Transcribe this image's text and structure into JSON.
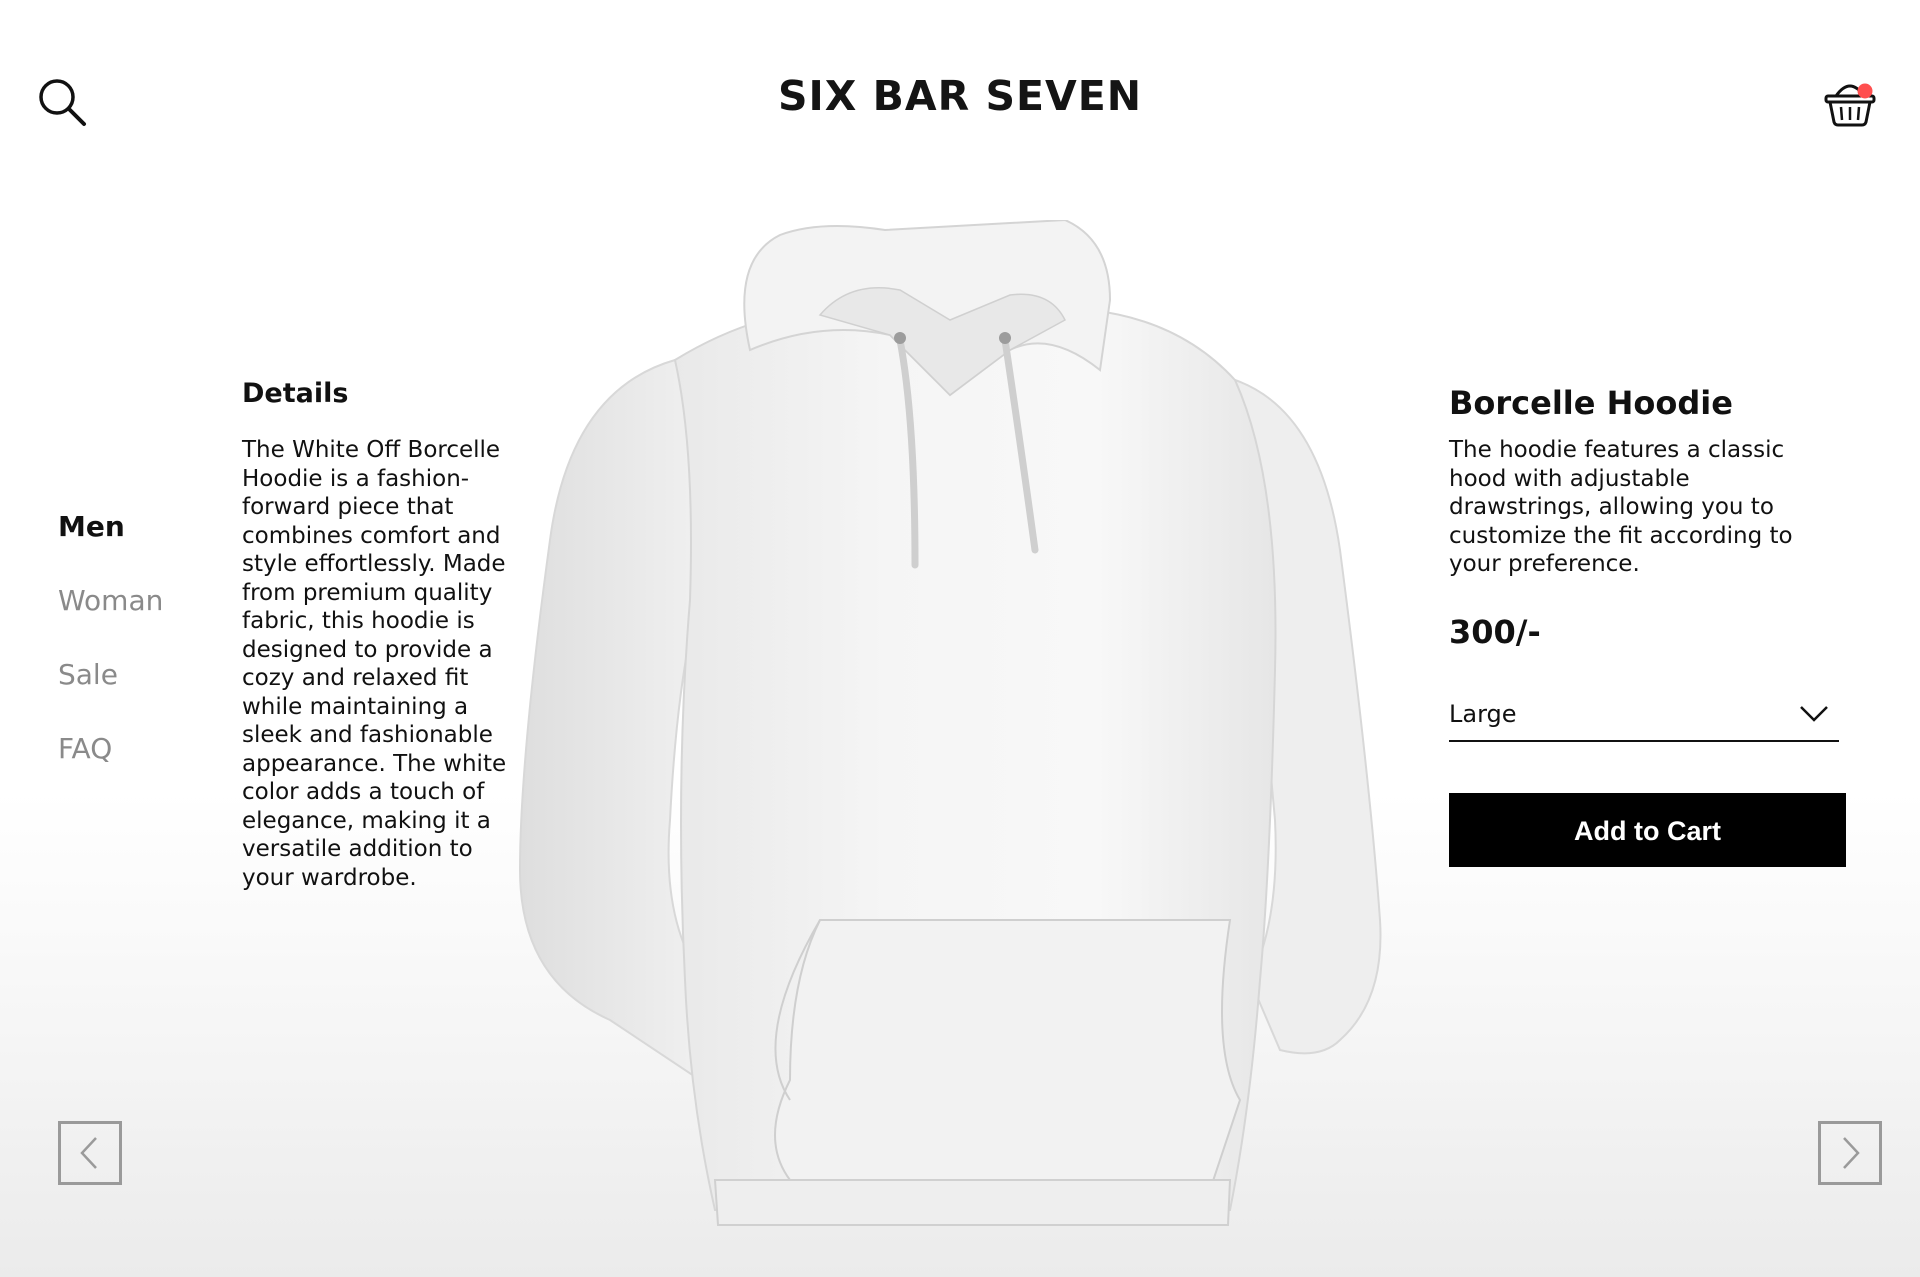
{
  "header": {
    "brand": "SIX BAR SEVEN",
    "search_icon": "search-icon",
    "cart_icon": "basket-icon",
    "cart_badge_color": "#ff4f4f"
  },
  "nav": {
    "items": [
      {
        "label": "Men",
        "active": true
      },
      {
        "label": "Woman",
        "active": false
      },
      {
        "label": "Sale",
        "active": false
      },
      {
        "label": "FAQ",
        "active": false
      }
    ]
  },
  "details": {
    "heading": "Details",
    "text": "The White Off Borcelle Hoodie is a fashion-forward piece that combines comfort and style effortlessly. Made from premium quality fabric, this hoodie is designed to provide a cozy and relaxed fit while maintaining a sleek and fashionable appearance. The white color adds a touch of elegance, making it a versatile addition to your wardrobe."
  },
  "product": {
    "name": "Borcelle Hoodie",
    "description": "The hoodie features a classic hood with adjustable drawstrings, allowing you to customize the fit according to your preference.",
    "price": "300/-",
    "size_selected": "Large",
    "add_to_cart_label": "Add to Cart",
    "image_icon": "white-hoodie-image"
  },
  "carousel": {
    "prev_icon": "chevron-left-icon",
    "next_icon": "chevron-right-icon"
  }
}
